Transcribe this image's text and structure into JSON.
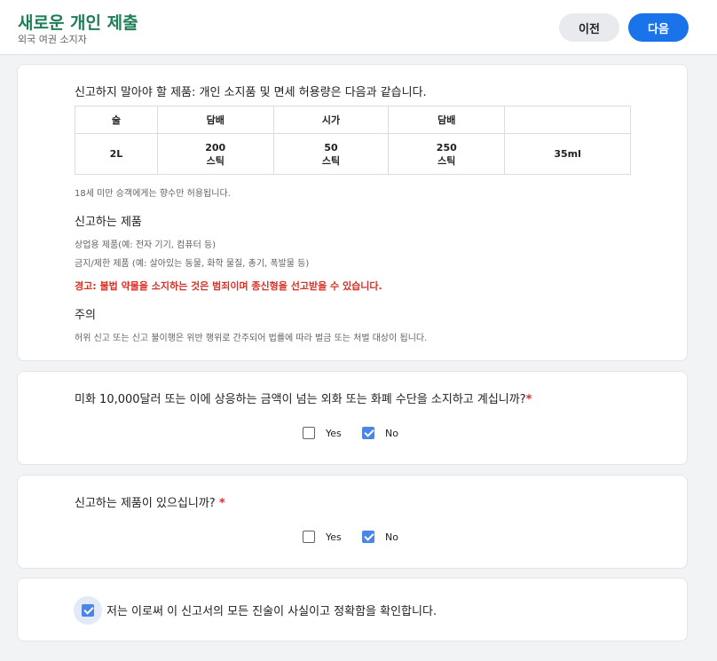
{
  "header": {
    "title": "새로운 개인 제출",
    "subtitle": "외국 여권 소지자",
    "prev_label": "이전",
    "next_label": "다음"
  },
  "info": {
    "intro": "신고하지 말아야 할 제품: 개인 소지품 및 면세 허용량은 다음과 같습니다.",
    "table": {
      "headers": [
        "술",
        "담배",
        "시가",
        "담배",
        ""
      ],
      "row": [
        [
          "2L"
        ],
        [
          "200",
          "스틱"
        ],
        [
          "50",
          "스틱"
        ],
        [
          "250",
          "스틱"
        ],
        [
          "35ml"
        ]
      ]
    },
    "note": "18세 미만 승객에게는 향수만 허용됩니다.",
    "declare_heading": "신고하는 제품",
    "declare_items": [
      "상업용 제품(예: 전자 기기, 컴퓨터 등)",
      "금지/제한 제품 (예: 살아있는 동물, 화학 물질, 총기, 폭발물 등)"
    ],
    "warning": "경고: 불법 약물을 소지하는 것은 범죄이며 종신형을 선고받을 수 있습니다.",
    "caution_heading": "주의",
    "caution_text": "허위 신고 또는 신고 불이행은 위반 행위로 간주되어 법률에 따라 벌금 또는 처벌 대상이 됩니다."
  },
  "q1": {
    "question": "미화 10,000달러 또는 이에 상응하는 금액이 넘는 외화 또는 화폐 수단을 소지하고 계십니까?",
    "required_mark": "*",
    "yes_label": "Yes",
    "no_label": "No",
    "yes_checked": false,
    "no_checked": true
  },
  "q2": {
    "question": "신고하는 제품이 있으십니까?",
    "required_mark": "*",
    "yes_label": "Yes",
    "no_label": "No",
    "yes_checked": false,
    "no_checked": true
  },
  "confirm": {
    "label": "저는 이로써 이 신고서의 모든 진술이 사실이고 정확함을 확인합니다.",
    "checked": true
  },
  "colors": {
    "brand_green": "#1e7e57",
    "primary_blue": "#1a73e8",
    "warning_red": "#d93025",
    "checkbox_blue": "#4a86e8"
  },
  "icons": [
    "checkmark-icon"
  ]
}
